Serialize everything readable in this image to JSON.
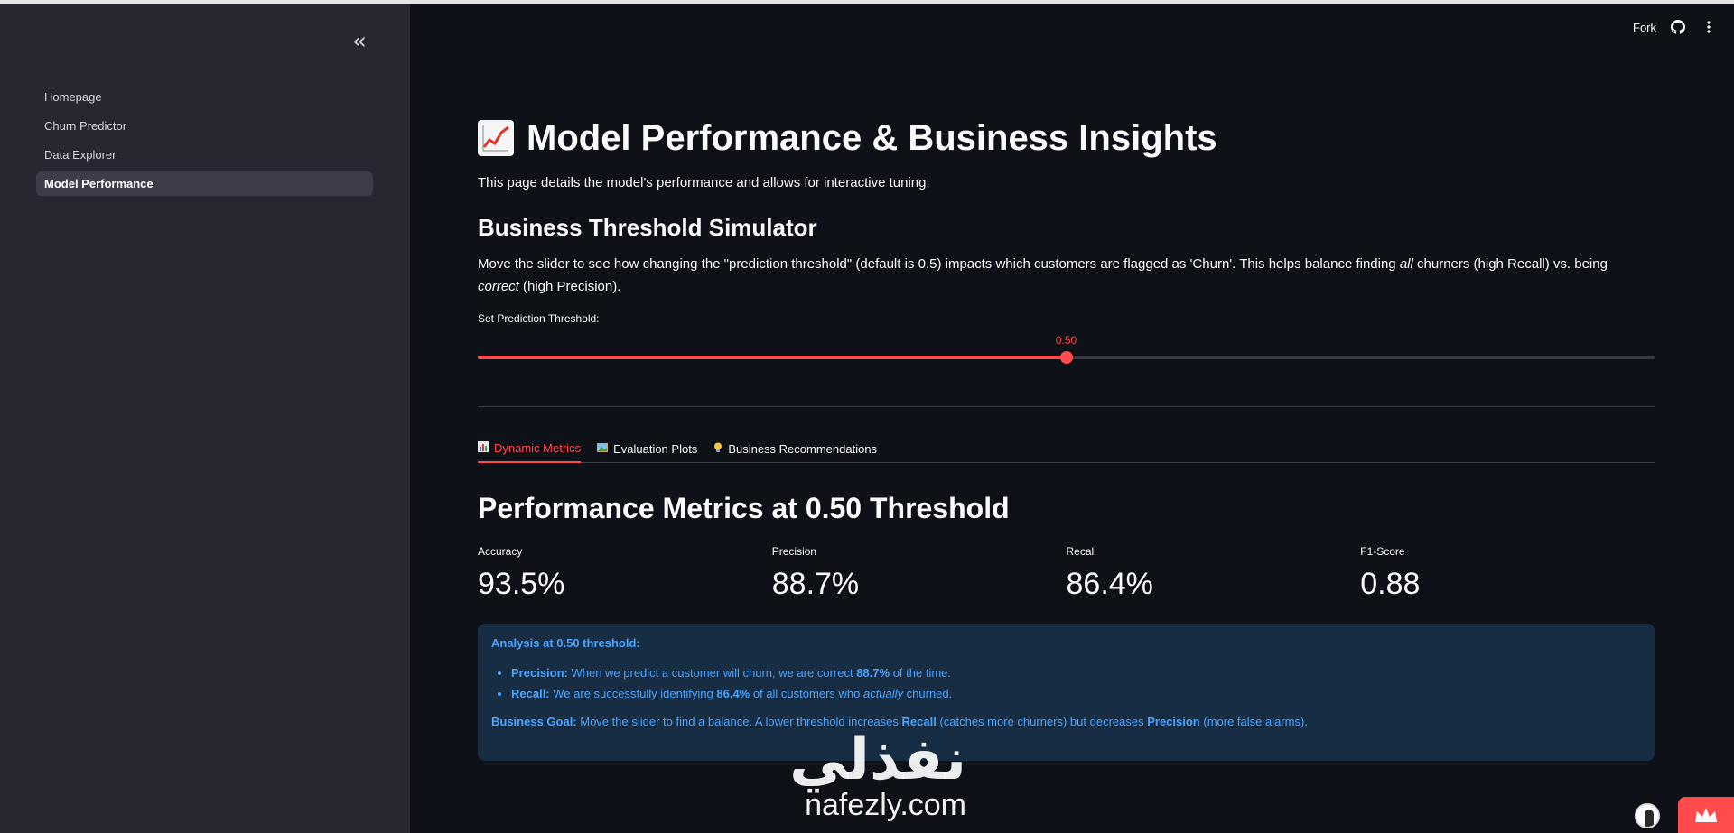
{
  "sidebar": {
    "collapse_glyph": "«",
    "items": [
      {
        "label": "Homepage"
      },
      {
        "label": "Churn Predictor"
      },
      {
        "label": "Data Explorer"
      },
      {
        "label": "Model Performance"
      }
    ],
    "active_index": 3
  },
  "header": {
    "fork_label": "Fork",
    "icons": [
      "github-icon",
      "more-vert-icon"
    ]
  },
  "main": {
    "title": "Model Performance & Business Insights",
    "title_emoji": "chart-increasing-icon",
    "intro": "This page details the model's performance and allows for interactive tuning.",
    "simulator": {
      "title": "Business Threshold Simulator",
      "desc_part1": "Move the slider to see how changing the \"prediction threshold\" (default is 0.5) impacts which customers are flagged as 'Churn'. This helps balance finding ",
      "desc_em1": "all",
      "desc_part2": " churners (high Recall) vs. being ",
      "desc_em2": "correct",
      "desc_part3": " (high Precision).",
      "slider_label": "Set Prediction Threshold:",
      "slider_value_text": "0.50",
      "slider_value": 0.5,
      "slider_min": 0,
      "slider_max": 1
    },
    "tabs": [
      {
        "label": "Dynamic Metrics",
        "icon": "bar-chart-icon"
      },
      {
        "label": "Evaluation Plots",
        "icon": "picture-icon"
      },
      {
        "label": "Business Recommendations",
        "icon": "light-bulb-icon"
      }
    ],
    "active_tab": 0,
    "metrics_title": "Performance Metrics at 0.50 Threshold",
    "metrics": [
      {
        "label": "Accuracy",
        "value": "93.5%"
      },
      {
        "label": "Precision",
        "value": "88.7%"
      },
      {
        "label": "Recall",
        "value": "86.4%"
      },
      {
        "label": "F1-Score",
        "value": "0.88"
      }
    ],
    "analysis": {
      "heading": "Analysis at 0.50 threshold:",
      "precision_label": "Precision:",
      "precision_text1": " When we predict a customer will churn, we are correct ",
      "precision_value": "88.7%",
      "precision_text2": " of the time.",
      "recall_label": "Recall:",
      "recall_text1": " We are successfully identifying ",
      "recall_value": "86.4%",
      "recall_text2": " of all customers who ",
      "recall_em": "actually",
      "recall_text3": " churned.",
      "goal_label": "Business Goal:",
      "goal_text1": " Move the slider to find a balance. A lower threshold increases ",
      "goal_recall": "Recall",
      "goal_text2": " (catches more churners) but decreases ",
      "goal_precision": "Precision",
      "goal_text3": " (more false alarms)."
    }
  },
  "watermark": {
    "arabic": "نفذلي",
    "latin": "nafezly.com"
  },
  "colors": {
    "accent": "#ff4b4b",
    "info_bg": "#172d43",
    "info_text": "#4aa3ff",
    "sidebar_bg": "#262730",
    "main_bg": "#0e1117"
  }
}
